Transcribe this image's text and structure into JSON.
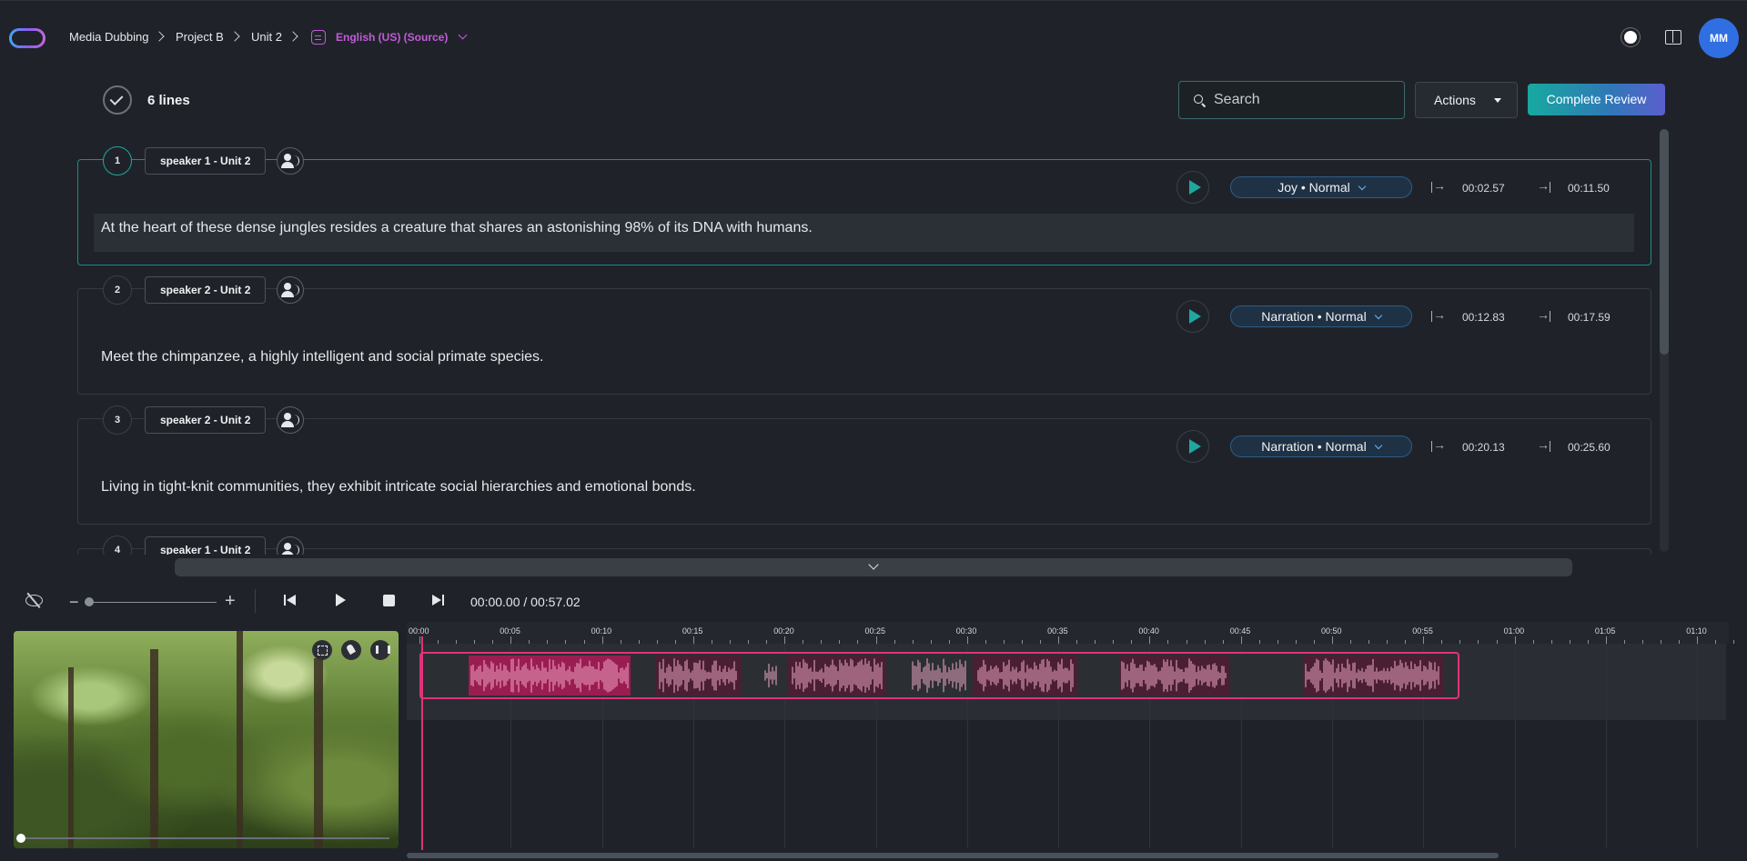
{
  "breadcrumb": {
    "items": [
      "Media Dubbing",
      "Project B",
      "Unit 2"
    ],
    "language": "English (US) (Source)"
  },
  "user": {
    "initials": "MM"
  },
  "toolbar": {
    "lines_count": "6 lines",
    "search_placeholder": "Search",
    "actions_label": "Actions",
    "complete_label": "Complete Review"
  },
  "lines": [
    {
      "number": "1",
      "speaker": "speaker 1 - Unit 2",
      "emotion": "Joy • Normal",
      "start": "00:02.57",
      "end": "00:11.50",
      "text": "At the heart of these dense jungles resides a creature that shares an astonishing 98% of its DNA with humans."
    },
    {
      "number": "2",
      "speaker": "speaker 2 - Unit 2",
      "emotion": "Narration • Normal",
      "start": "00:12.83",
      "end": "00:17.59",
      "text": "Meet the chimpanzee, a highly intelligent and social primate species."
    },
    {
      "number": "3",
      "speaker": "speaker 2 - Unit 2",
      "emotion": "Narration • Normal",
      "start": "00:20.13",
      "end": "00:25.60",
      "text": "Living in tight-knit communities, they exhibit intricate social hierarchies and emotional bonds."
    },
    {
      "number": "4",
      "speaker": "speaker 1 - Unit 2",
      "emotion": "",
      "start": "",
      "end": "",
      "text": ""
    }
  ],
  "player": {
    "time": "00:00.00 / 00:57.02",
    "zoom_out": "−",
    "zoom_in": "+"
  },
  "timeline": {
    "ticks": [
      "00:00",
      "00:05",
      "00:10",
      "00:15",
      "00:20",
      "00:25",
      "00:30",
      "00:35",
      "00:40",
      "00:45",
      "00:50",
      "00:55",
      "01:00",
      "01:05",
      "01:10"
    ]
  },
  "colors": {
    "accent": "#1fa7a0",
    "clip": "#e0337a",
    "language": "#c45bd8",
    "avatar": "#2f6fe2"
  },
  "icons": {
    "logo": "app-logo",
    "lang": "translate-icon",
    "theme": "sun-icon",
    "docs": "book-icon",
    "voice": "voice-icon",
    "play": "play-icon",
    "start": "start-time-icon",
    "end": "end-time-icon"
  }
}
